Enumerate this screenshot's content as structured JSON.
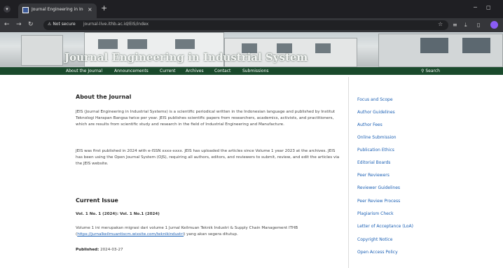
{
  "browser": {
    "tab_title": "Journal Engineering in Industri",
    "tab_close": "×",
    "new_tab": "+",
    "not_secure": "Not secure",
    "url": "journal-live.ithb.ac.id/EIS/index"
  },
  "banner": {
    "title": "Journal Engineering in Industrial System"
  },
  "nav": {
    "items": [
      "About the Journal",
      "Announcements",
      "Current",
      "Archives",
      "Contact",
      "Submissions"
    ],
    "search": "Search"
  },
  "main": {
    "about_heading": "About the Journal",
    "about_p1": "JEIS (Journal Engineering in Industrial Systems) is a scientific periodical written in the Indonesian language and published by Institut Teknologi Harapan Bangsa twice per year. JEIS publishes scientific papers from researchers, academics, activists, and practitioners, which are results from scientific study and research in the field of Industrial Engineering and Manufacture.",
    "about_p2": "JEIS was first published in 2024 with e-ISSN xxxx-xxxx. JEIS has uploaded the articles since Volume 1 year 2023 at the archives. JEIS has been using the Open Journal System (OJS), requiring all authors, editors, and reviewers to submit, review, and edit the articles via the JEIS website.",
    "current_heading": "Current Issue",
    "issue_title": "Vol. 1 No. 1 (2024): Vol. 1 No.1 (2024)",
    "issue_desc_before": "Volume 1 ini merupakan migrasi dari volume 1 Jurnal Keilmuan Teknik Industri & Supply Chain Management ITHB (",
    "issue_link": "https://jurnalkeilmuantiscm.wixsite.com/teknikindustri",
    "issue_desc_after": ") yang akan segera ditutup.",
    "published_label": "Published:",
    "published_date": "2024-03-27"
  },
  "sidebar": {
    "items": [
      "Focus and Scope",
      "Author Guidelines",
      "Author Fees",
      "Online Submission",
      "Publication Ethics",
      "Editorial Boards",
      "Peer Reviewers",
      "Reviewer Guidelines",
      "Peer Review Process",
      "Plagiarism Check",
      "Letter of Acceptance (LoA)",
      "Copyright Notice",
      "Open Access Policy"
    ]
  }
}
